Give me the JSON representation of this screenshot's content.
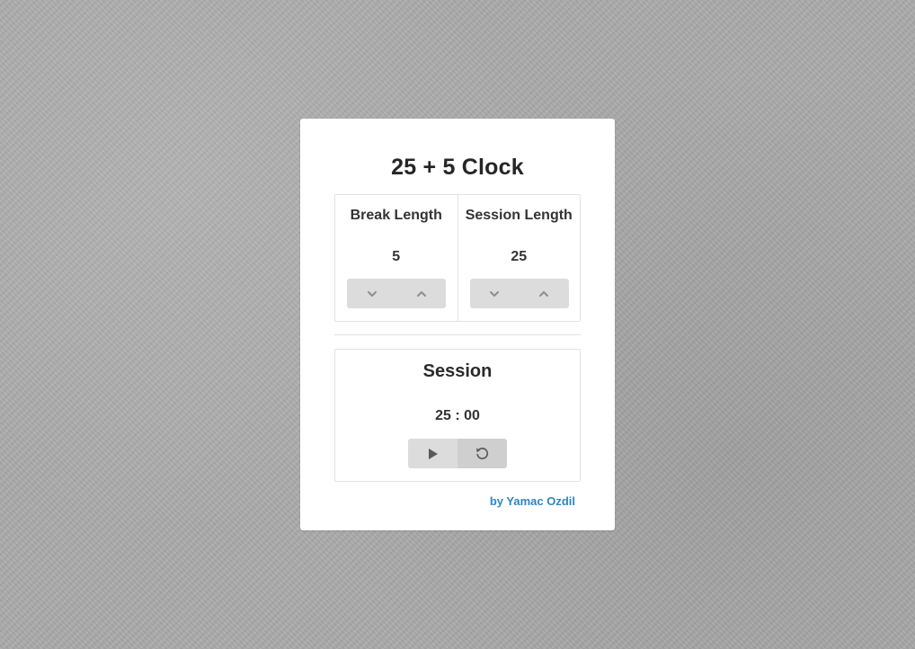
{
  "app": {
    "title": "25 + 5 Clock"
  },
  "settings": {
    "break": {
      "label": "Break Length",
      "value": "5",
      "decrement_icon": "chevron-down-icon",
      "increment_icon": "chevron-up-icon"
    },
    "session": {
      "label": "Session Length",
      "value": "25",
      "decrement_icon": "chevron-down-icon",
      "increment_icon": "chevron-up-icon"
    }
  },
  "timer": {
    "label": "Session",
    "time_left": "25 : 00",
    "play_icon": "play-icon",
    "reset_icon": "reset-icon"
  },
  "footer": {
    "author_link": "by Yamac Ozdil"
  },
  "colors": {
    "background": "#ababab",
    "card": "#ffffff",
    "button": "#dcdcdc",
    "link": "#2f86c0"
  }
}
